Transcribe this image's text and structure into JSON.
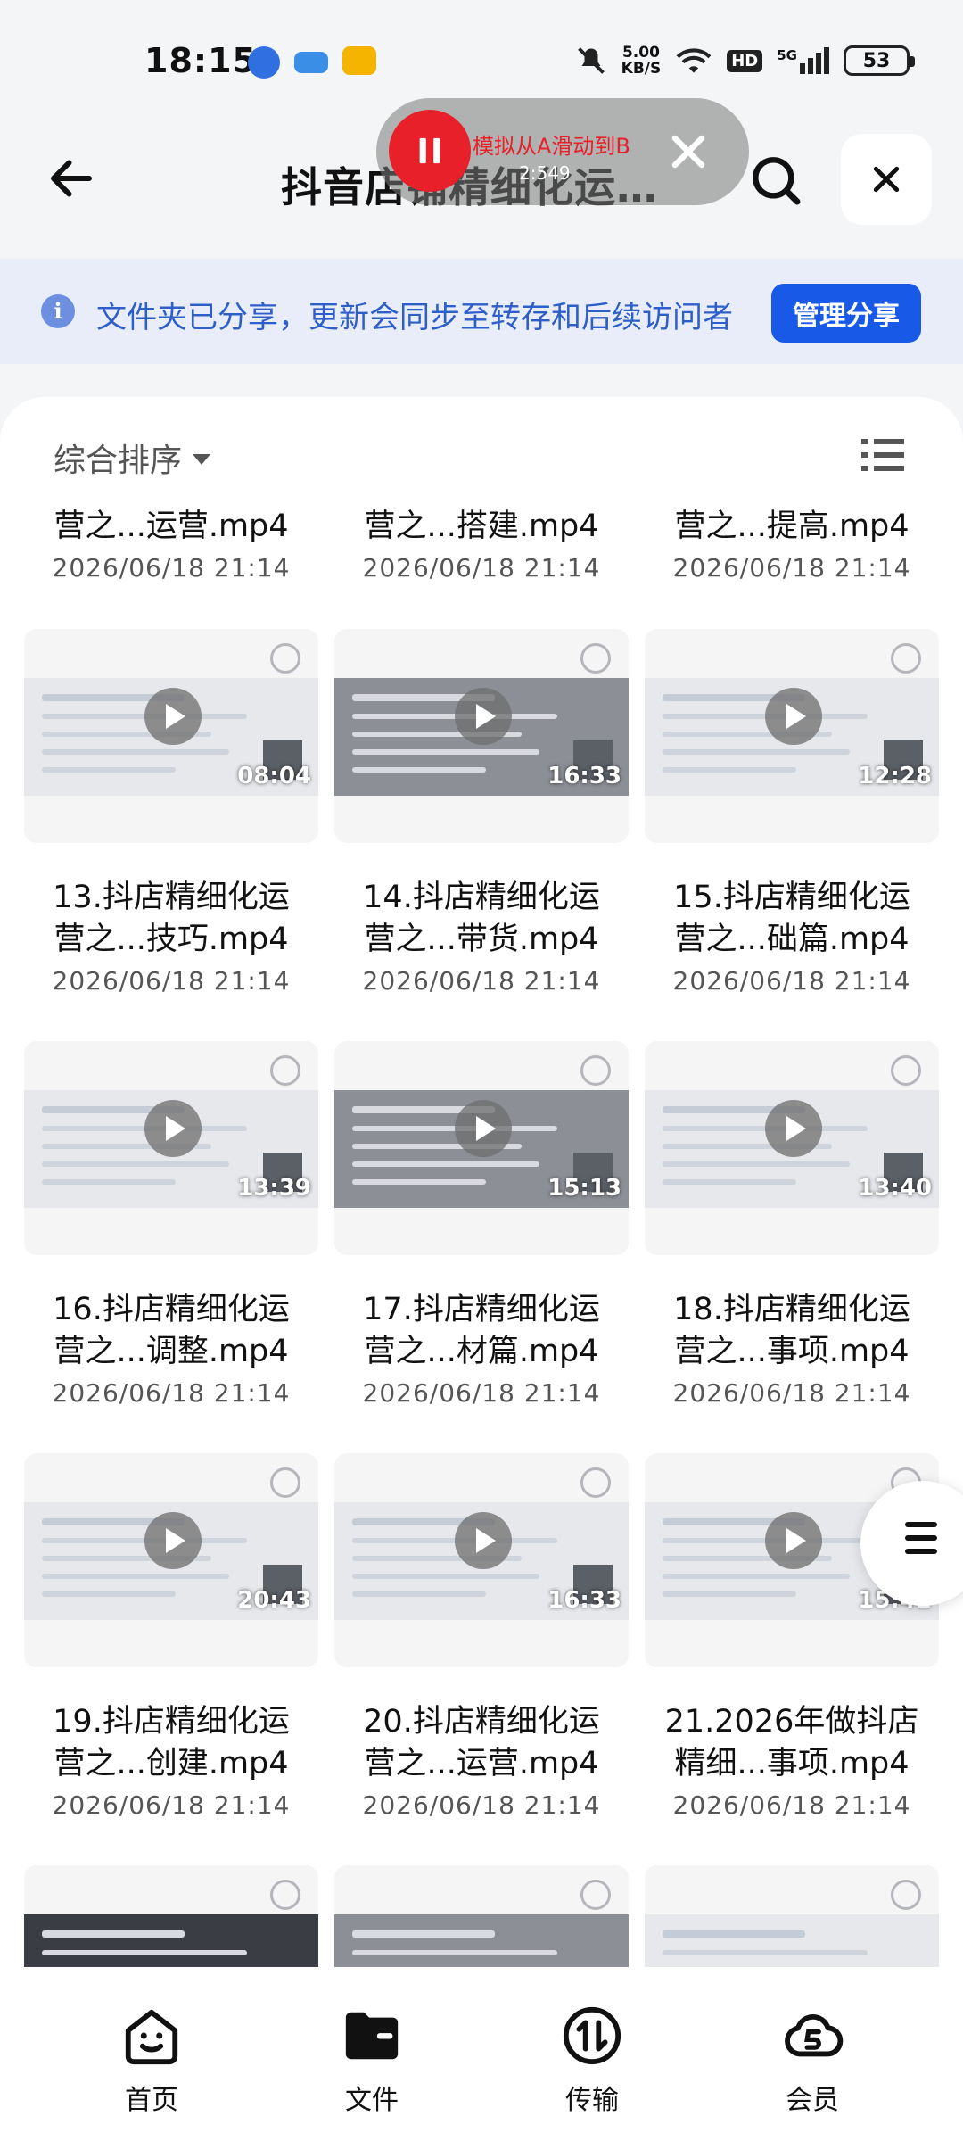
{
  "status_bar": {
    "time": "18:15",
    "net_speed_value": "5.00",
    "net_speed_unit": "KB/S",
    "hd": "HD",
    "signal": "5G",
    "battery": "53"
  },
  "header": {
    "title": "抖音店铺精细化运…"
  },
  "recorder": {
    "text": "模拟从A滑动到B",
    "timer": "2:549"
  },
  "share_banner": {
    "text": "文件夹已分享，更新会同步至转存和后续访问者",
    "button": "管理分享"
  },
  "sort": {
    "label": "综合排序"
  },
  "top_partial_row": [
    {
      "name": "营之...运营.mp4",
      "date": "2026/06/18 21:14"
    },
    {
      "name": "营之...搭建.mp4",
      "date": "2026/06/18 21:14"
    },
    {
      "name": "营之...提高.mp4",
      "date": "2026/06/18 21:14"
    }
  ],
  "files": [
    {
      "line1": "13.抖店精细化运",
      "line2": "营之...技巧.mp4",
      "date": "2026/06/18 21:14",
      "duration": "08:04"
    },
    {
      "line1": "14.抖店精细化运",
      "line2": "营之...带货.mp4",
      "date": "2026/06/18 21:14",
      "duration": "16:33"
    },
    {
      "line1": "15.抖店精细化运",
      "line2": "营之...础篇.mp4",
      "date": "2026/06/18 21:14",
      "duration": "12:28"
    },
    {
      "line1": "16.抖店精细化运",
      "line2": "营之...调整.mp4",
      "date": "2026/06/18 21:14",
      "duration": "13:39"
    },
    {
      "line1": "17.抖店精细化运",
      "line2": "营之...材篇.mp4",
      "date": "2026/06/18 21:14",
      "duration": "15:13"
    },
    {
      "line1": "18.抖店精细化运",
      "line2": "营之...事项.mp4",
      "date": "2026/06/18 21:14",
      "duration": "13:40"
    },
    {
      "line1": "19.抖店精细化运",
      "line2": "营之...创建.mp4",
      "date": "2026/06/18 21:14",
      "duration": "20:43"
    },
    {
      "line1": "20.抖店精细化运",
      "line2": "营之...运营.mp4",
      "date": "2026/06/18 21:14",
      "duration": "16:33"
    },
    {
      "line1": "21.2026年做抖店",
      "line2": "精细...事项.mp4",
      "date": "2026/06/18 21:14",
      "duration": "15:42"
    }
  ],
  "bottom_nav": [
    {
      "label": "首页",
      "icon": "home-face-icon"
    },
    {
      "label": "文件",
      "icon": "folder-icon"
    },
    {
      "label": "传输",
      "icon": "transfer-icon"
    },
    {
      "label": "会员",
      "icon": "vip-cloud-icon"
    }
  ],
  "colors": {
    "accent": "#1959e8",
    "banner_bg": "#e8edf9",
    "banner_text": "#2e5ec8",
    "recorder_red": "#e8202a"
  }
}
